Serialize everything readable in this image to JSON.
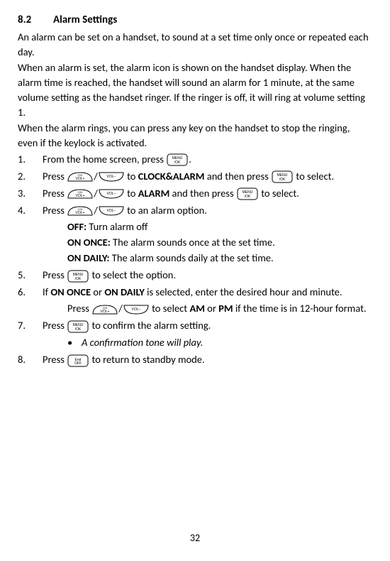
{
  "section": {
    "number": "8.2",
    "title": "Alarm Settings"
  },
  "intro": {
    "p1": "An alarm can be set on a handset, to sound at a set time only once or repeated each day.",
    "p2": "When an alarm is set, the alarm icon is shown on the handset display. When the alarm time is reached, the handset will sound an alarm for 1 minute, at the same volume setting as the handset ringer. If the ringer is off, it will ring at volume setting 1.",
    "p3": "When the alarm rings, you can press any key on the handset to stop the ringing, even if the keylock is activated."
  },
  "steps": {
    "s1a": "From the home screen, press ",
    "s1b": ".",
    "s2a": "Press ",
    "s2b": "/",
    "s2c": " to ",
    "s2d": "CLOCK&ALARM",
    "s2e": " and then press ",
    "s2f": " to select.",
    "s3a": "Press ",
    "s3b": "/",
    "s3c": " to ",
    "s3d": "ALARM",
    "s3e": " and then press ",
    "s3f": " to select.",
    "s4a": "Press ",
    "s4b": "/",
    "s4c": " to an alarm option.",
    "off_label": "OFF:",
    "off_text": " Turn alarm off",
    "once_label": "ON ONCE:",
    "once_text": " The alarm sounds once at the set time.",
    "daily_label": "ON DAILY:",
    "daily_text": " The alarm sounds daily at the set time.",
    "s5a": "Press ",
    "s5b": " to select the option.",
    "s6a": "If ",
    "s6b": "ON ONCE",
    "s6c": " or ",
    "s6d": "ON DAILY",
    "s6e": " is selected, enter the desired hour and minute.",
    "s6f": "Press ",
    "s6g": "/",
    "s6h": " to select ",
    "s6i": "AM",
    "s6j": " or ",
    "s6k": "PM",
    "s6l": " if the time is in 12-hour format.",
    "s7a": "Press ",
    "s7b": " to confirm the alarm setting.",
    "note": "A confirmation tone will play.",
    "s8a": "Press ",
    "s8b": " to return to standby mode."
  },
  "nums": {
    "n1": "1.",
    "n2": "2.",
    "n3": "3.",
    "n4": "4.",
    "n5": "5.",
    "n6": "6.",
    "n7": "7.",
    "n8": "8."
  },
  "bullet": "•",
  "page": "32"
}
